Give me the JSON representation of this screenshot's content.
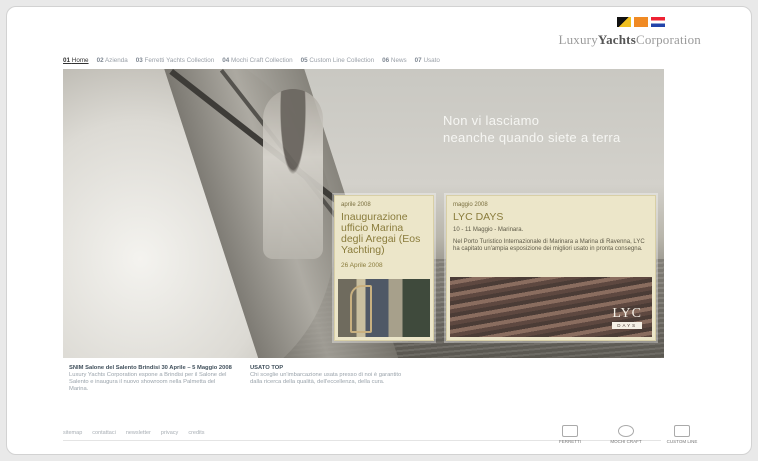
{
  "brand": {
    "prefix": "Luxury",
    "bold": "Yachts",
    "suffix": "Corporation"
  },
  "nav": [
    {
      "num": "01",
      "label": "Home"
    },
    {
      "num": "02",
      "label": "Azienda"
    },
    {
      "num": "03",
      "label": "Ferretti Yachts Collection"
    },
    {
      "num": "04",
      "label": "Mochi Craft Collection"
    },
    {
      "num": "05",
      "label": "Custom Line Collection"
    },
    {
      "num": "06",
      "label": "News"
    },
    {
      "num": "07",
      "label": "Usato"
    }
  ],
  "hero": {
    "slogan_line1": "Non vi lasciamo",
    "slogan_line2": "neanche quando siete a terra"
  },
  "card1": {
    "date": "aprile 2008",
    "title": "Inaugurazione ufficio Marina degli Aregai (Eos Yachting)",
    "sub": "26 Aprile 2008"
  },
  "card2": {
    "date": "maggio 2008",
    "title": "LYC DAYS",
    "sub": "10 - 11 Maggio - Marinara.",
    "body": "Nel Porto Turistico Internazionale di Marinara a Marina di Ravenna, LYC ha capitato un'ampia esposizione dei migliori usato in pronta consegna.",
    "logo_big": "LYC",
    "logo_small": "DAYS"
  },
  "news": [
    {
      "heading": "SNIM Salone del Salento Brindisi 30 Aprile – 5 Maggio 2008",
      "text": "Luxury Yachts Corporation espone a Brindisi per il Salone del Salento e inaugura il nuovo showroom nella Palmetta del Marina."
    },
    {
      "heading": "USATO TOP",
      "text": "Chi sceglie un'imbarcazione usata presso di noi è garantito dalla ricerca della qualità, dell'eccellenza, della cura."
    }
  ],
  "footer": [
    "sitemap",
    "contattaci",
    "newsletter",
    "privacy",
    "credits"
  ],
  "badges": [
    "FERRETTI",
    "MOCHI CRAFT",
    "CUSTOM LINE"
  ]
}
